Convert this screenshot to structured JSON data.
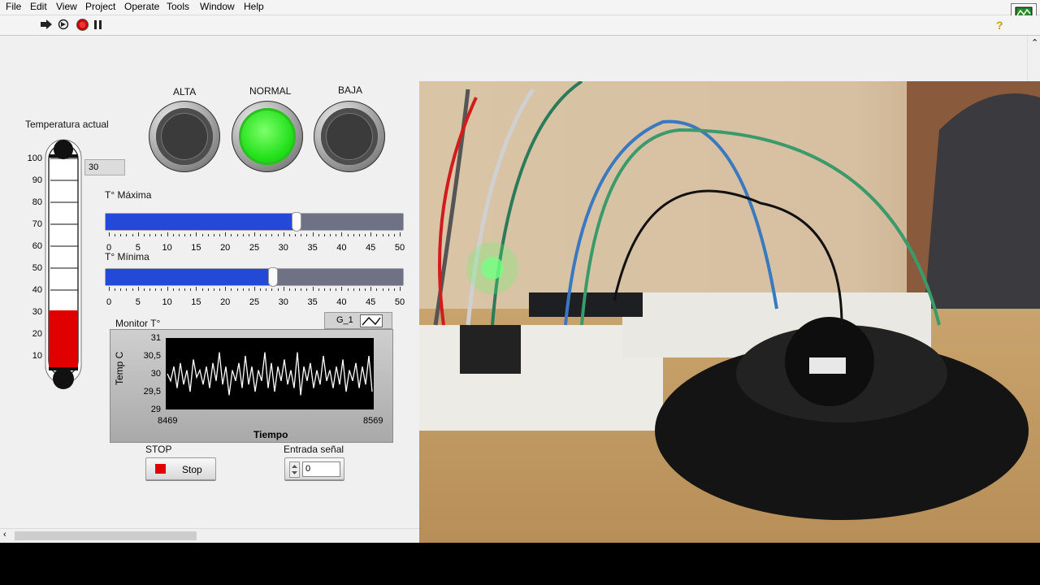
{
  "menu": [
    "File",
    "Edit",
    "View",
    "Project",
    "Operate",
    "Tools",
    "Window",
    "Help"
  ],
  "panel": {
    "temp_label": "Temperatura actual",
    "temp_value": "30",
    "thermo_scale": [
      "100",
      "90",
      "80",
      "70",
      "60",
      "50",
      "40",
      "30",
      "20",
      "10"
    ],
    "thermo_level": 30,
    "leds": [
      {
        "label": "ALTA",
        "on": false
      },
      {
        "label": "NORMAL",
        "on": true
      },
      {
        "label": "BAJA",
        "on": false
      }
    ],
    "slider_max": {
      "label": "T° Máxima",
      "value": 32
    },
    "slider_min": {
      "label": "T° Mínima",
      "value": 28
    },
    "slider_scale": [
      "0",
      "5",
      "10",
      "15",
      "20",
      "25",
      "30",
      "35",
      "40",
      "45",
      "50"
    ],
    "stop_label": "STOP",
    "stop_button": "Stop",
    "input_label": "Entrada señal",
    "input_value": "0"
  },
  "chart_data": {
    "type": "line",
    "title": "Monitor T°",
    "legend": "G_1",
    "xlabel": "Tiempo",
    "ylabel": "Temp C",
    "xlim": [
      8469,
      8569
    ],
    "ylim": [
      29,
      31
    ],
    "y_ticks": [
      "31",
      "30,5",
      "30",
      "29,5",
      "29"
    ],
    "x_ticks": [
      "8469",
      "8569"
    ],
    "series": [
      {
        "values": [
          30,
          29.8,
          30.2,
          29.6,
          30.3,
          29.7,
          30.1,
          29.5,
          30.4,
          29.9,
          30.1,
          29.7,
          30.2,
          29.6,
          30.3,
          29.8,
          30.6,
          29.7,
          30.2,
          29.4,
          30.1,
          29.8,
          30.3,
          29.6,
          30.5,
          29.7,
          30.2,
          29.5,
          30.1,
          29.8,
          30.6,
          29.6,
          30.3,
          29.5,
          30.2,
          29.8,
          30.4,
          29.7,
          30.1,
          29.6,
          30.6,
          29.4,
          30.2,
          29.8,
          30.3,
          29.6,
          30.1,
          29.7,
          30.5,
          29.8,
          30.1,
          29.6,
          30.2,
          29.7,
          30.4,
          29.5,
          30.1,
          29.8,
          30.3,
          29.6,
          30.2,
          29.7,
          30.5,
          29.5
        ]
      }
    ]
  },
  "colors": {
    "led_on": "#22e01a",
    "slider_fill": "#2448d8",
    "thermo_fill": "#e00000",
    "stop_red": "#e00000",
    "plot_bg": "#000000",
    "plot_line": "#ffffff"
  },
  "icons": [
    "run-arrow-icon",
    "run-continuous-icon",
    "abort-icon",
    "pause-icon",
    "help-icon",
    "vi-icon"
  ]
}
